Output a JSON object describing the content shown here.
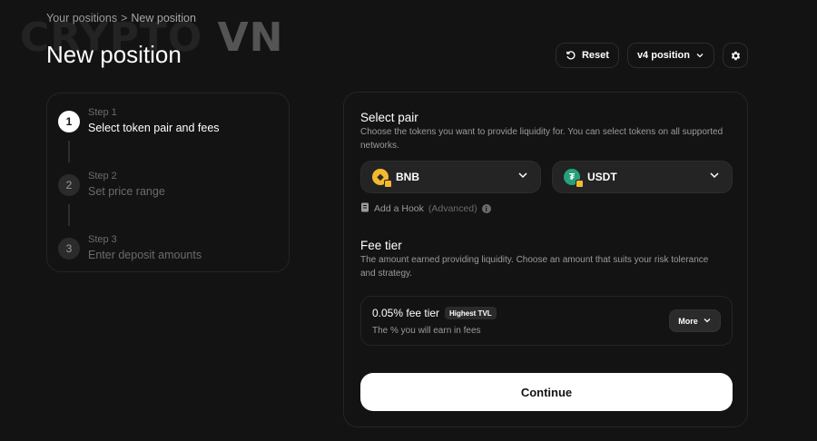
{
  "watermark": {
    "text_main": "CRYPTO",
    "text_accent": "VN"
  },
  "breadcrumb": {
    "parent": "Your positions",
    "separator": ">",
    "current": "New position"
  },
  "page_title": "New position",
  "controls": {
    "reset_label": "Reset",
    "version_label": "v4 position"
  },
  "steps": [
    {
      "num": "1",
      "sub": "Step 1",
      "name": "Select token pair and fees",
      "active": true
    },
    {
      "num": "2",
      "sub": "Step 2",
      "name": "Set price range",
      "active": false
    },
    {
      "num": "3",
      "sub": "Step 3",
      "name": "Enter deposit amounts",
      "active": false
    }
  ],
  "select_pair": {
    "title": "Select pair",
    "description": "Choose the tokens you want to provide liquidity for. You can select tokens on all supported networks.",
    "token_a": {
      "symbol": "BNB",
      "icon": "bnb-logo",
      "color": "#f3ba2f"
    },
    "token_b": {
      "symbol": "USDT",
      "icon": "usdt-logo",
      "color": "#26a17b"
    },
    "hook_label": "Add a Hook",
    "hook_note": "(Advanced)"
  },
  "fee_tier": {
    "title": "Fee tier",
    "description": "The amount earned providing liquidity. Choose an amount that suits your risk tolerance and strategy.",
    "selected_label": "0.05% fee tier",
    "badge": "Highest TVL",
    "sub": "The % you will earn in fees",
    "more_label": "More"
  },
  "continue_label": "Continue"
}
